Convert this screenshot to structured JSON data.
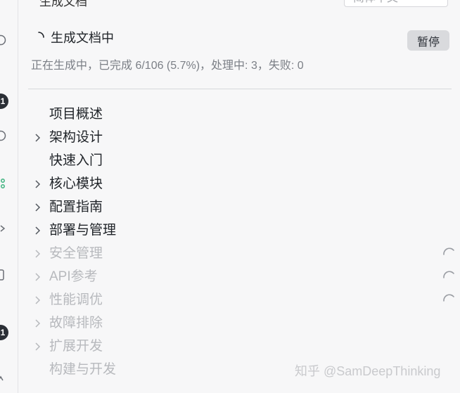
{
  "header": {
    "cut_title": "生成文档",
    "cut_select": "简体中文",
    "status_title": "生成文档中",
    "pause_label": "暂停",
    "progress_text": "正在生成中，已完成 6/106 (5.7%)，处理中: 3，失败: 0",
    "progress_completed": 6,
    "progress_total": 106,
    "progress_percent": 5.7,
    "in_progress": 3,
    "failed": 0
  },
  "activity_bar": {
    "badges": [
      "1",
      "1"
    ]
  },
  "tree": [
    {
      "label": "项目概述",
      "expandable": false,
      "state": "done"
    },
    {
      "label": "架构设计",
      "expandable": true,
      "state": "done"
    },
    {
      "label": "快速入门",
      "expandable": false,
      "state": "done"
    },
    {
      "label": "核心模块",
      "expandable": true,
      "state": "done"
    },
    {
      "label": "配置指南",
      "expandable": true,
      "state": "done"
    },
    {
      "label": "部署与管理",
      "expandable": true,
      "state": "done"
    },
    {
      "label": "安全管理",
      "expandable": true,
      "state": "generating"
    },
    {
      "label": "API参考",
      "expandable": true,
      "state": "generating"
    },
    {
      "label": "性能调优",
      "expandable": true,
      "state": "generating"
    },
    {
      "label": "故障排除",
      "expandable": true,
      "state": "pending"
    },
    {
      "label": "扩展开发",
      "expandable": true,
      "state": "pending"
    },
    {
      "label": "构建与开发",
      "expandable": false,
      "state": "pending"
    }
  ],
  "watermark": "知乎 @SamDeepThinking",
  "colors": {
    "background": "#f7f7f8",
    "text": "#1f2328",
    "muted": "#7b7f86",
    "pending": "#b7b9bd",
    "button_bg": "#d9dadd",
    "badge_bg": "#2b2f36",
    "accent_green": "#3fb37f"
  }
}
